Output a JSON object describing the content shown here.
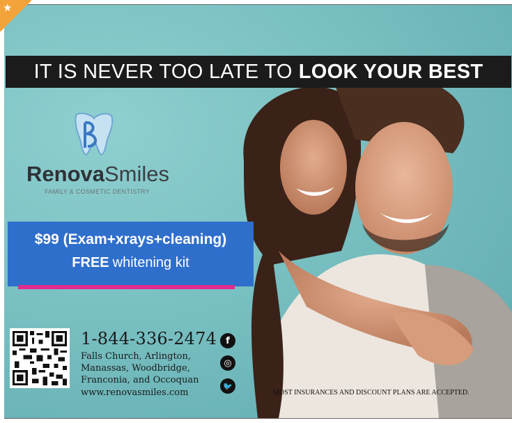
{
  "headline": {
    "regular": "IT IS NEVER TOO LATE TO",
    "bold": "LOOK YOUR BEST"
  },
  "logo": {
    "name_bold": "Renova",
    "name_regular": "Smiles",
    "tagline": "FAMILY & COSMETIC DENTISTRY"
  },
  "promo": {
    "line1": "$99 (Exam+xrays+cleaning)",
    "line2_bold": "FREE",
    "line2_rest": "whitening kit"
  },
  "contact": {
    "phone": "1-844-336-2474",
    "locations": [
      "Falls Church, Arlington,",
      "Manassas, Woodbridge,",
      "Franconia, and Occoquan"
    ],
    "website": "www.renovasmiles.com"
  },
  "social": {
    "facebook": "f",
    "instagram": "◎",
    "twitter": "🐦"
  },
  "disclaimer": "MOST INSURANCES AND DISCOUNT PLANS ARE ACCEPTED.",
  "corner_badge": "★",
  "colors": {
    "background": "#79c0c2",
    "headline_bg": "#1b1b1b",
    "promo_bg": "#2f6fcc",
    "promo_bar": "#e02c8f",
    "corner": "#f2a43a"
  }
}
